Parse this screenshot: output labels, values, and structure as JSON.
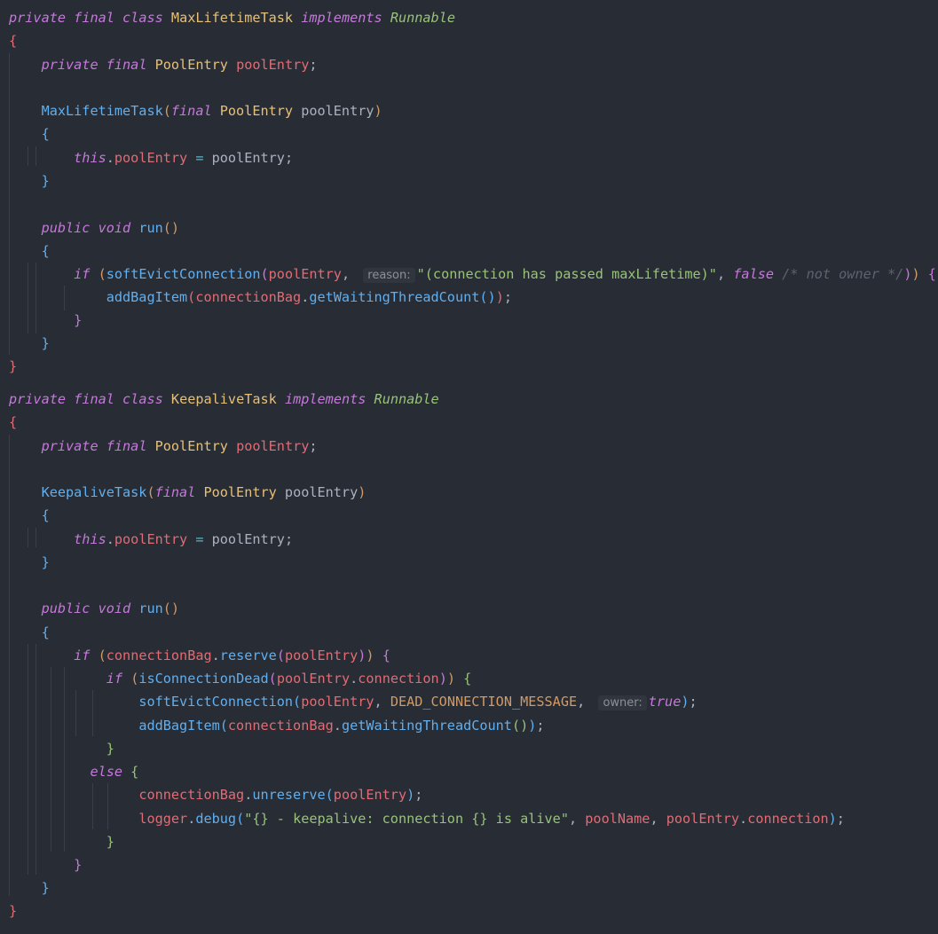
{
  "code_lines": [
    {
      "tokens": [
        [
          "kw",
          "private"
        ],
        [
          "plain",
          " "
        ],
        [
          "kw",
          "final"
        ],
        [
          "plain",
          " "
        ],
        [
          "kw",
          "class"
        ],
        [
          "plain",
          " "
        ],
        [
          "class",
          "MaxLifetimeTask"
        ],
        [
          "plain",
          " "
        ],
        [
          "kw",
          "implements"
        ],
        [
          "plain",
          " "
        ],
        [
          "iface",
          "Runnable"
        ]
      ]
    },
    {
      "tokens": [
        [
          "b5",
          "{"
        ]
      ]
    },
    {
      "tokens": [
        [
          "plain",
          "    "
        ],
        [
          "kw",
          "private"
        ],
        [
          "plain",
          " "
        ],
        [
          "kw",
          "final"
        ],
        [
          "plain",
          " "
        ],
        [
          "type",
          "PoolEntry"
        ],
        [
          "plain",
          " "
        ],
        [
          "field",
          "poolEntry"
        ],
        [
          "punct",
          ";"
        ]
      ]
    },
    {
      "tokens": []
    },
    {
      "tokens": [
        [
          "plain",
          "    "
        ],
        [
          "fn",
          "MaxLifetimeTask"
        ],
        [
          "b1",
          "("
        ],
        [
          "kw",
          "final"
        ],
        [
          "plain",
          " "
        ],
        [
          "type",
          "PoolEntry"
        ],
        [
          "plain",
          " poolEntry"
        ],
        [
          "b1",
          ")"
        ]
      ]
    },
    {
      "tokens": [
        [
          "plain",
          "    "
        ],
        [
          "b3",
          "{"
        ]
      ]
    },
    {
      "tokens": [
        [
          "plain",
          "        "
        ],
        [
          "kw",
          "this"
        ],
        [
          "punct",
          "."
        ],
        [
          "field",
          "poolEntry"
        ],
        [
          "plain",
          " "
        ],
        [
          "op",
          "="
        ],
        [
          "plain",
          " poolEntry"
        ],
        [
          "punct",
          ";"
        ]
      ]
    },
    {
      "tokens": [
        [
          "plain",
          "    "
        ],
        [
          "b3",
          "}"
        ]
      ]
    },
    {
      "tokens": []
    },
    {
      "tokens": [
        [
          "plain",
          "    "
        ],
        [
          "kw",
          "public"
        ],
        [
          "plain",
          " "
        ],
        [
          "kw",
          "void"
        ],
        [
          "plain",
          " "
        ],
        [
          "fn",
          "run"
        ],
        [
          "b1",
          "()"
        ]
      ]
    },
    {
      "tokens": [
        [
          "plain",
          "    "
        ],
        [
          "b3",
          "{"
        ]
      ]
    },
    {
      "tokens": [
        [
          "plain",
          "        "
        ],
        [
          "kw",
          "if"
        ],
        [
          "plain",
          " "
        ],
        [
          "b1",
          "("
        ],
        [
          "fn",
          "softEvictConnection"
        ],
        [
          "b2",
          "("
        ],
        [
          "field",
          "poolEntry"
        ],
        [
          "punct",
          ","
        ],
        [
          "plain",
          " "
        ],
        [
          "hint",
          "reason:"
        ],
        [
          "str",
          "\"(connection has passed maxLifetime)\""
        ],
        [
          "punct",
          ","
        ],
        [
          "plain",
          " "
        ],
        [
          "bool",
          "false"
        ],
        [
          "plain",
          " "
        ],
        [
          "cmt",
          "/* not owner */"
        ],
        [
          "b2",
          ")"
        ],
        [
          "b1",
          ")"
        ],
        [
          "plain",
          " "
        ],
        [
          "b2",
          "{"
        ]
      ]
    },
    {
      "tokens": [
        [
          "plain",
          "            "
        ],
        [
          "fn",
          "addBagItem"
        ],
        [
          "b5",
          "("
        ],
        [
          "field",
          "connectionBag"
        ],
        [
          "punct",
          "."
        ],
        [
          "fn",
          "getWaitingThreadCount"
        ],
        [
          "b3",
          "()"
        ],
        [
          "b5",
          ")"
        ],
        [
          "punct",
          ";"
        ]
      ]
    },
    {
      "tokens": [
        [
          "plain",
          "        "
        ],
        [
          "b2",
          "}"
        ]
      ]
    },
    {
      "tokens": [
        [
          "plain",
          "    "
        ],
        [
          "b3",
          "}"
        ]
      ]
    },
    {
      "tokens": [
        [
          "b5",
          "}"
        ]
      ]
    },
    {
      "tokens": [
        [
          "kw",
          "private"
        ],
        [
          "plain",
          " "
        ],
        [
          "kw",
          "final"
        ],
        [
          "plain",
          " "
        ],
        [
          "kw",
          "class"
        ],
        [
          "plain",
          " "
        ],
        [
          "class",
          "KeepaliveTask"
        ],
        [
          "plain",
          " "
        ],
        [
          "kw",
          "implements"
        ],
        [
          "plain",
          " "
        ],
        [
          "iface",
          "Runnable"
        ]
      ]
    },
    {
      "tokens": [
        [
          "b5",
          "{"
        ]
      ]
    },
    {
      "tokens": [
        [
          "plain",
          "    "
        ],
        [
          "kw",
          "private"
        ],
        [
          "plain",
          " "
        ],
        [
          "kw",
          "final"
        ],
        [
          "plain",
          " "
        ],
        [
          "type",
          "PoolEntry"
        ],
        [
          "plain",
          " "
        ],
        [
          "field",
          "poolEntry"
        ],
        [
          "punct",
          ";"
        ]
      ]
    },
    {
      "tokens": []
    },
    {
      "tokens": [
        [
          "plain",
          "    "
        ],
        [
          "fn",
          "KeepaliveTask"
        ],
        [
          "b1",
          "("
        ],
        [
          "kw",
          "final"
        ],
        [
          "plain",
          " "
        ],
        [
          "type",
          "PoolEntry"
        ],
        [
          "plain",
          " poolEntry"
        ],
        [
          "b1",
          ")"
        ]
      ]
    },
    {
      "tokens": [
        [
          "plain",
          "    "
        ],
        [
          "b3",
          "{"
        ]
      ]
    },
    {
      "tokens": [
        [
          "plain",
          "        "
        ],
        [
          "kw",
          "this"
        ],
        [
          "punct",
          "."
        ],
        [
          "field",
          "poolEntry"
        ],
        [
          "plain",
          " "
        ],
        [
          "op",
          "="
        ],
        [
          "plain",
          " poolEntry"
        ],
        [
          "punct",
          ";"
        ]
      ]
    },
    {
      "tokens": [
        [
          "plain",
          "    "
        ],
        [
          "b3",
          "}"
        ]
      ]
    },
    {
      "tokens": []
    },
    {
      "tokens": [
        [
          "plain",
          "    "
        ],
        [
          "kw",
          "public"
        ],
        [
          "plain",
          " "
        ],
        [
          "kw",
          "void"
        ],
        [
          "plain",
          " "
        ],
        [
          "fn",
          "run"
        ],
        [
          "b1",
          "()"
        ]
      ]
    },
    {
      "tokens": [
        [
          "plain",
          "    "
        ],
        [
          "b3",
          "{"
        ]
      ]
    },
    {
      "tokens": [
        [
          "plain",
          "        "
        ],
        [
          "kw",
          "if"
        ],
        [
          "plain",
          " "
        ],
        [
          "b1",
          "("
        ],
        [
          "field",
          "connectionBag"
        ],
        [
          "punct",
          "."
        ],
        [
          "fn",
          "reserve"
        ],
        [
          "b2",
          "("
        ],
        [
          "field",
          "poolEntry"
        ],
        [
          "b2",
          ")"
        ],
        [
          "b1",
          ")"
        ],
        [
          "plain",
          " "
        ],
        [
          "b2",
          "{"
        ]
      ]
    },
    {
      "tokens": [
        [
          "plain",
          "            "
        ],
        [
          "kw",
          "if"
        ],
        [
          "plain",
          " "
        ],
        [
          "b1",
          "("
        ],
        [
          "fn",
          "isConnectionDead"
        ],
        [
          "b2",
          "("
        ],
        [
          "field",
          "poolEntry"
        ],
        [
          "punct",
          "."
        ],
        [
          "field",
          "connection"
        ],
        [
          "b2",
          ")"
        ],
        [
          "b1",
          ")"
        ],
        [
          "plain",
          " "
        ],
        [
          "b4",
          "{"
        ]
      ]
    },
    {
      "tokens": [
        [
          "plain",
          "                "
        ],
        [
          "fn",
          "softEvictConnection"
        ],
        [
          "b3",
          "("
        ],
        [
          "field",
          "poolEntry"
        ],
        [
          "punct",
          ","
        ],
        [
          "plain",
          " "
        ],
        [
          "const",
          "DEAD_CONNECTION_MESSAGE"
        ],
        [
          "punct",
          ","
        ],
        [
          "plain",
          " "
        ],
        [
          "hint",
          "owner:"
        ],
        [
          "bool",
          "true"
        ],
        [
          "b3",
          ")"
        ],
        [
          "punct",
          ";"
        ]
      ]
    },
    {
      "tokens": [
        [
          "plain",
          "                "
        ],
        [
          "fn",
          "addBagItem"
        ],
        [
          "b3",
          "("
        ],
        [
          "field",
          "connectionBag"
        ],
        [
          "punct",
          "."
        ],
        [
          "fn",
          "getWaitingThreadCount"
        ],
        [
          "b4",
          "()"
        ],
        [
          "b3",
          ")"
        ],
        [
          "punct",
          ";"
        ]
      ]
    },
    {
      "tokens": [
        [
          "plain",
          "            "
        ],
        [
          "b4",
          "}"
        ]
      ]
    },
    {
      "tokens": [
        [
          "plain",
          "          "
        ],
        [
          "kw",
          "else"
        ],
        [
          "plain",
          " "
        ],
        [
          "b4",
          "{"
        ]
      ]
    },
    {
      "tokens": [
        [
          "plain",
          "                "
        ],
        [
          "field",
          "connectionBag"
        ],
        [
          "punct",
          "."
        ],
        [
          "fn",
          "unreserve"
        ],
        [
          "b3",
          "("
        ],
        [
          "field",
          "poolEntry"
        ],
        [
          "b3",
          ")"
        ],
        [
          "punct",
          ";"
        ]
      ]
    },
    {
      "tokens": [
        [
          "plain",
          "                "
        ],
        [
          "field",
          "logger"
        ],
        [
          "punct",
          "."
        ],
        [
          "fn",
          "debug"
        ],
        [
          "b3",
          "("
        ],
        [
          "str",
          "\"{} - keepalive: connection {} is alive\""
        ],
        [
          "punct",
          ","
        ],
        [
          "plain",
          " "
        ],
        [
          "field",
          "poolName"
        ],
        [
          "punct",
          ","
        ],
        [
          "plain",
          " "
        ],
        [
          "field",
          "poolEntry"
        ],
        [
          "punct",
          "."
        ],
        [
          "field",
          "connection"
        ],
        [
          "b3",
          ")"
        ],
        [
          "punct",
          ";"
        ]
      ]
    },
    {
      "tokens": [
        [
          "plain",
          "            "
        ],
        [
          "b4",
          "}"
        ]
      ]
    },
    {
      "tokens": [
        [
          "plain",
          "        "
        ],
        [
          "b2",
          "}"
        ]
      ]
    },
    {
      "tokens": [
        [
          "plain",
          "    "
        ],
        [
          "b3",
          "}"
        ]
      ]
    },
    {
      "tokens": [
        [
          "b5",
          "}"
        ]
      ]
    }
  ]
}
